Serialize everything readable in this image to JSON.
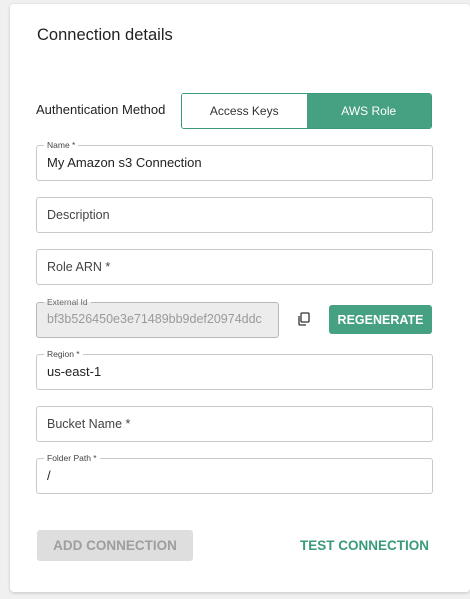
{
  "title": "Connection details",
  "auth": {
    "label": "Authentication Method",
    "options": [
      "Access Keys",
      "AWS Role"
    ],
    "selected": "AWS Role"
  },
  "fields": {
    "name": {
      "label": "Name *",
      "value": "My Amazon s3 Connection"
    },
    "description": {
      "placeholder": "Description"
    },
    "role_arn": {
      "placeholder": "Role ARN *"
    },
    "external_id": {
      "label": "External Id",
      "value": "bf3b526450e3e71489bb9def20974ddc"
    },
    "region": {
      "label": "Region *",
      "value": "us-east-1"
    },
    "bucket_name": {
      "placeholder": "Bucket Name *"
    },
    "folder_path": {
      "label": "Folder Path *",
      "value": "/"
    }
  },
  "buttons": {
    "regenerate": "REGENERATE",
    "add_connection": "ADD CONNECTION",
    "test_connection": "TEST CONNECTION"
  },
  "colors": {
    "accent": "#46a082",
    "disabled_bg": "#dedede",
    "disabled_text": "#9e9e9e"
  },
  "icons": {
    "copy": "copy-icon"
  }
}
